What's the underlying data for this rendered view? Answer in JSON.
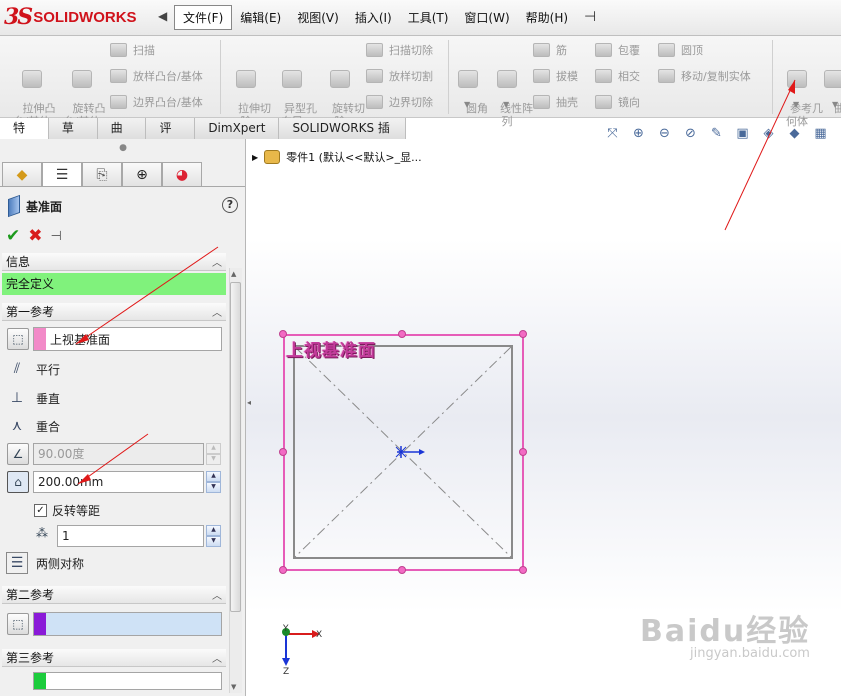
{
  "app": {
    "logo_mark": "3S",
    "logo_text": "SOLIDWORKS"
  },
  "menu": {
    "items": [
      "文件(F)",
      "编辑(E)",
      "视图(V)",
      "插入(I)",
      "工具(T)",
      "窗口(W)",
      "帮助(H)"
    ],
    "active_index": 0
  },
  "command_manager": {
    "features": {
      "extrude_boss": "拉伸凸\n台/基体",
      "revolve_boss": "旋转凸\n台/基体",
      "sweep": "扫描",
      "loft": "放样凸台/基体",
      "boundary_boss": "边界凸台/基体",
      "extrude_cut": "拉伸切\n除",
      "hole_wizard": "异型孔\n向导",
      "revolve_cut": "旋转切\n除",
      "swept_cut": "扫描切除",
      "lofted_cut": "放样切割",
      "boundary_cut": "边界切除",
      "fillet": "圆角",
      "linear_pattern": "线性阵\n列",
      "rib": "筋",
      "draft": "拔模",
      "shell": "抽壳",
      "wrap": "包覆",
      "intersect": "相交",
      "mirror": "镜向",
      "dome": "圆顶",
      "move_copy": "移动/复制实体",
      "reference_geometry": "参考几\n何体",
      "curves": "曲线"
    }
  },
  "tabs": [
    "特征",
    "草图",
    "曲面",
    "评估",
    "DimXpert",
    "SOLIDWORKS 插件"
  ],
  "active_tab_index": 0,
  "feature_tree": {
    "part_label": "零件1  (默认<<默认>_显..."
  },
  "panel": {
    "title": "基准面",
    "help": "?",
    "ok": "✔",
    "cancel": "✖",
    "pushpin": "⊣",
    "message_group": {
      "header": "信息",
      "status": "完全定义",
      "status_color": "#80f27c"
    },
    "first_reference": {
      "header": "第一参考",
      "selection": "上视基准面",
      "swatch_color": "#f28ac8",
      "options": {
        "parallel": "平行",
        "perpendicular": "垂直",
        "coincident": "重合"
      },
      "angle_value": "90.00度",
      "offset_value": "200.00mm",
      "flip_offset_label": "反转等距",
      "flip_offset_checked": true,
      "instances_value": "1",
      "mid_plane_label": "两侧对称"
    },
    "second_reference": {
      "header": "第二参考",
      "swatch_color": "#8a1ad8"
    },
    "third_reference": {
      "header": "第三参考",
      "swatch_color": "#1ccc3c"
    }
  },
  "viewport": {
    "plane_label": "上视基准面",
    "plane_color": "#e65cb8",
    "triad": {
      "x": "X",
      "y": "Y",
      "z": "Z"
    }
  },
  "watermark": {
    "main": "Baidu经验",
    "sub": "jingyan.baidu.com"
  }
}
